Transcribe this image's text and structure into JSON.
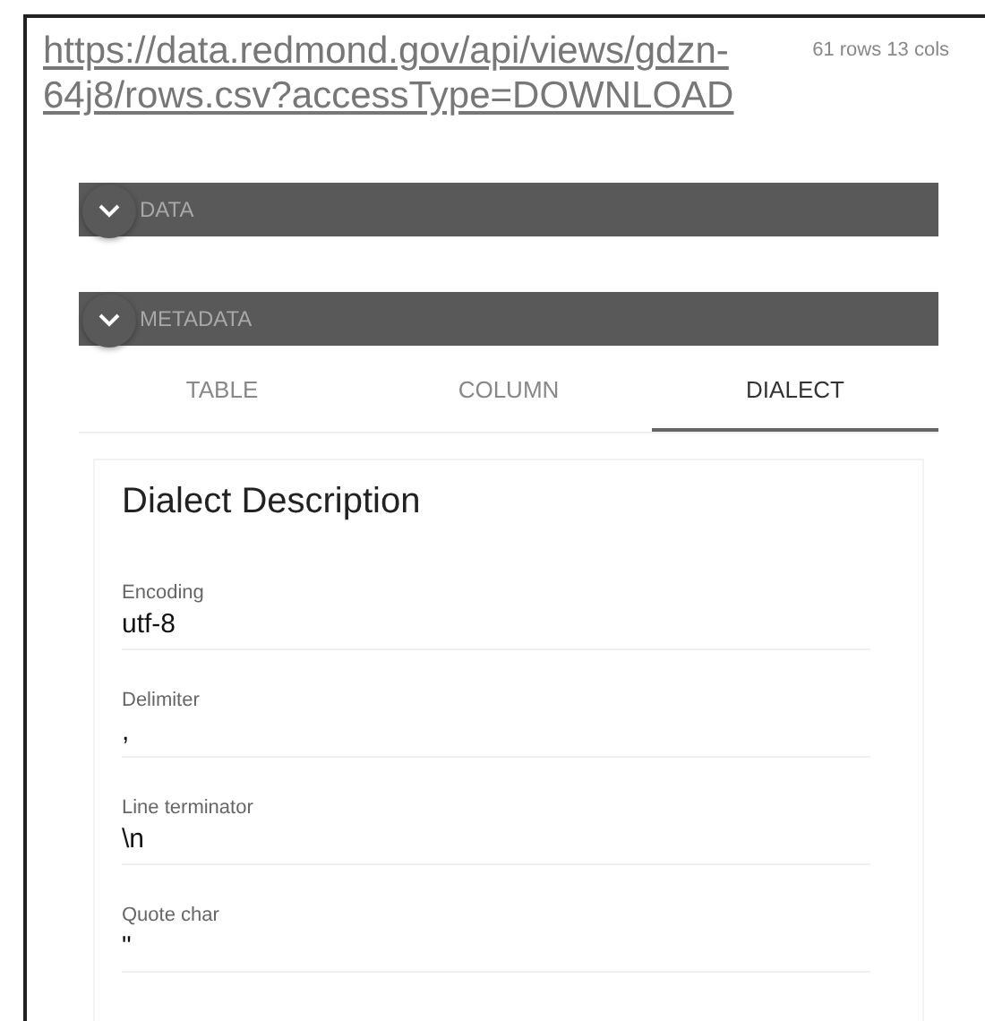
{
  "header": {
    "url": "https://data.redmond.gov/api/views/gdzn-64j8/rows.csv?accessType=DOWNLOAD",
    "summary": "61 rows 13 cols"
  },
  "sections": [
    {
      "title": "DATA"
    },
    {
      "title": "METADATA"
    }
  ],
  "tabs": [
    {
      "label": "TABLE",
      "selected": false
    },
    {
      "label": "COLUMN",
      "selected": false
    },
    {
      "label": "DIALECT",
      "selected": true
    }
  ],
  "dialect": {
    "title": "Dialect Description",
    "fields": [
      {
        "label": "Encoding",
        "value": "utf-8"
      },
      {
        "label": "Delimiter",
        "value": ","
      },
      {
        "label": "Line terminator",
        "value": "\\n"
      },
      {
        "label": "Quote char",
        "value": "\""
      }
    ]
  }
}
